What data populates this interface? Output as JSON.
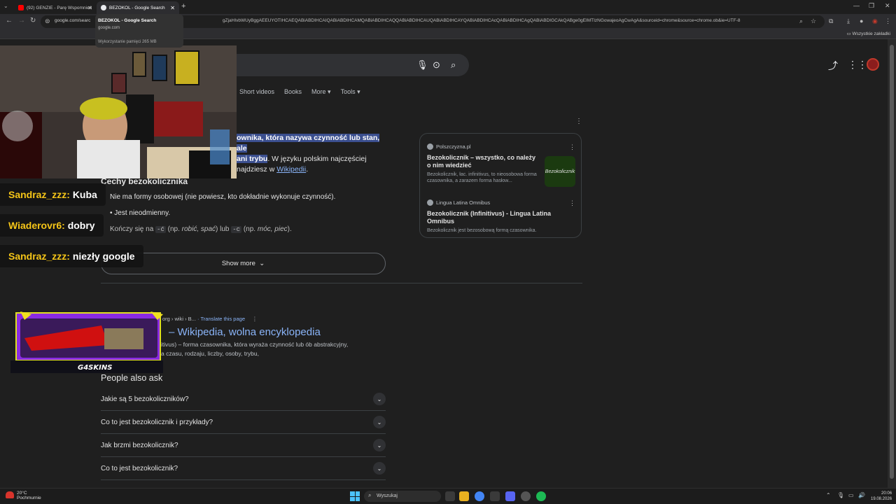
{
  "browser": {
    "tabs": [
      {
        "label": "(92) GENZIE - Parę Wspomnień",
        "favicon_color": "#ff0000"
      },
      {
        "label": "BEZOKOL - Google Search",
        "favicon_color": "#4285f4"
      }
    ],
    "new_tab": "+",
    "url_short": "google.com/searc",
    "url_rest": "gZjaHIvbWUyBggAEEUYOTIHCAEQABiABDIHCAIQABiABDIHCAMQABiABDIHCAQQABiABDIHCAUQABiABDIHCAYQABiABDIHCAcQABiABDIHCAgQABiABDIGCAkQABge0gEIMTIzNGowajeoAgCwAgA&sourceid=chrome&source=chrome.ob&ie=UTF-8",
    "bookmarks_label": "Wszystkie zakładki",
    "tooltip": {
      "title": "BEZOKOL - Google Search",
      "domain": "google.com",
      "memory": "Wykorzystanie pamięci 265 MB"
    }
  },
  "google": {
    "tabs": [
      "Short videos",
      "Books",
      "More ▾",
      "Tools ▾"
    ],
    "definition": {
      "hl1": "ownika, która nazywa czynność lub stan, ale",
      "hl2": "ani trybu",
      "plain": ". W języku polskim najczęściej",
      "plain2": "najdziesz w",
      "link": "Wikipedii",
      "dot": "."
    },
    "features_heading": "Cechy bezokolicznika",
    "features": [
      "Nie ma formy osobowej (nie powiesz, kto dokładnie wykonuje czynność).",
      "Jest nieodmienny."
    ],
    "feature3_prefix": "Kończy się na",
    "feature3_code1": "-ć",
    "feature3_mid1": "(np.",
    "feature3_ex1": "robić, spać",
    "feature3_mid2": ") lub",
    "feature3_code2": "-c",
    "feature3_mid3": "(np.",
    "feature3_ex2": "móc, piec",
    "feature3_end": ").",
    "show_more": "Show more",
    "side_panel": [
      {
        "source": "Polszczyzna.pl",
        "title": "Bezokolicznik – wszystko, co należy o nim wiedzieć",
        "snippet": "Bezokolicznik, łac. infinitivus, to nieosobowa forma czasownika, a zarazem forma hasłow...",
        "thumb_text": "Bezokolicznik"
      },
      {
        "source": "Lingua Latina Omnibus",
        "title": "Bezokolicznik (Infinitivus) - Lingua Latina Omnibus",
        "snippet": "Bezokolicznik jest bezosobową formą czasownika."
      }
    ],
    "result": {
      "crumb": "org › wiki › B...",
      "translate": "· Translate this page",
      "title": "– Wikipedia, wolna encyklopedia",
      "snippet1": "itivus) – forma czasownika, która wyraża czynność lub ób abstrakcyjny,",
      "snippet2": "a czasu, rodzaju, liczby, osoby, trybu,"
    },
    "paa_heading": "People also ask",
    "paa": [
      "Jakie są 5 bezokoliczników?",
      "Co to jest bezokolicznik i przykłady?",
      "Jak brzmi bezokolicznik?",
      "Co to jest bezokolicznik?"
    ]
  },
  "chat": [
    {
      "user": "Sandraz_zzz:",
      "text": "Kuba"
    },
    {
      "user": "Wiaderovr6:",
      "text": "dobry"
    },
    {
      "user": "Sandraz_zzz:",
      "text": "niezły google"
    }
  ],
  "sponsor": {
    "brand": "G4SKINS"
  },
  "taskbar": {
    "temp": "20°C",
    "weather": "Pochmurnie",
    "search_placeholder": "Wyszukaj",
    "time": "20:06",
    "date": "19.08.2026"
  }
}
